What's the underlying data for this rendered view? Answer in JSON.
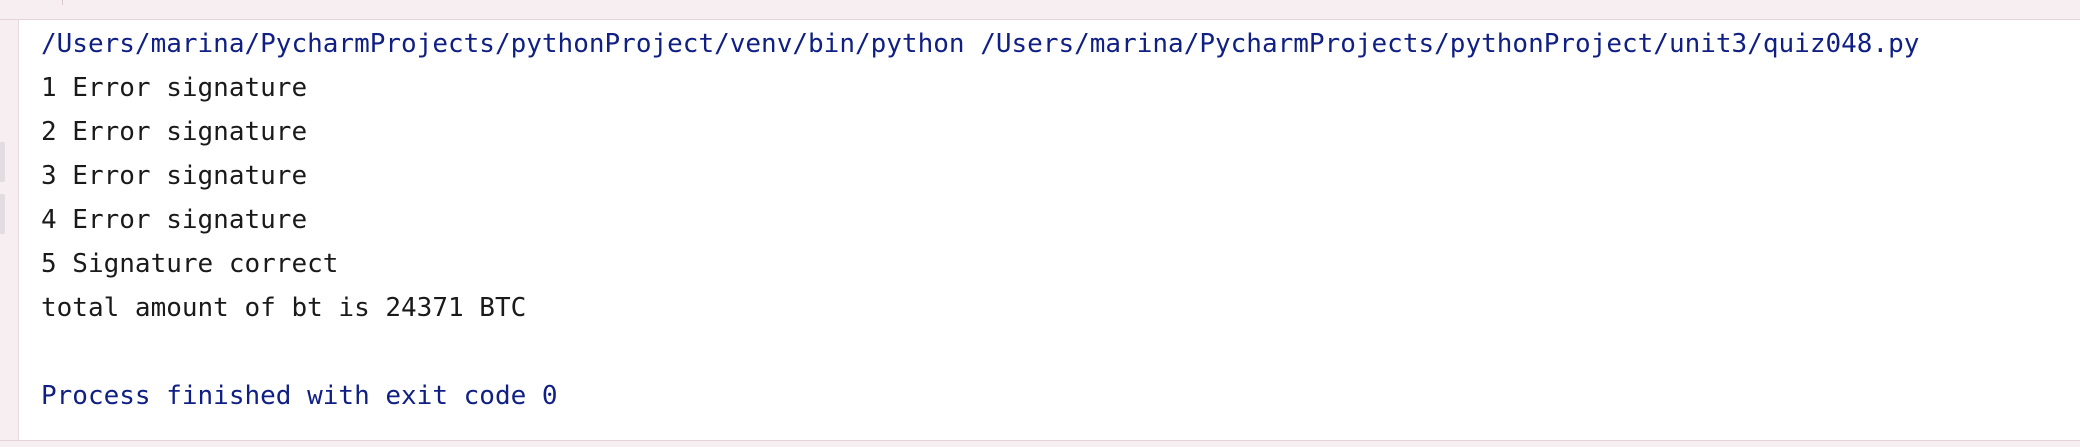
{
  "console": {
    "command": "/Users/marina/PycharmProjects/pythonProject/venv/bin/python /Users/marina/PycharmProjects/pythonProject/unit3/quiz048.py",
    "output_lines": [
      "1 Error signature",
      "2 Error signature",
      "3 Error signature",
      "4 Error signature",
      "5 Signature correct",
      "total amount of bt is 24371 BTC"
    ],
    "exit_message": "Process finished with exit code 0"
  },
  "colors": {
    "path_text": "#0f1f84",
    "output_text": "#1a1a1a",
    "background": "#ffffff",
    "frame": "#f7eef2"
  }
}
